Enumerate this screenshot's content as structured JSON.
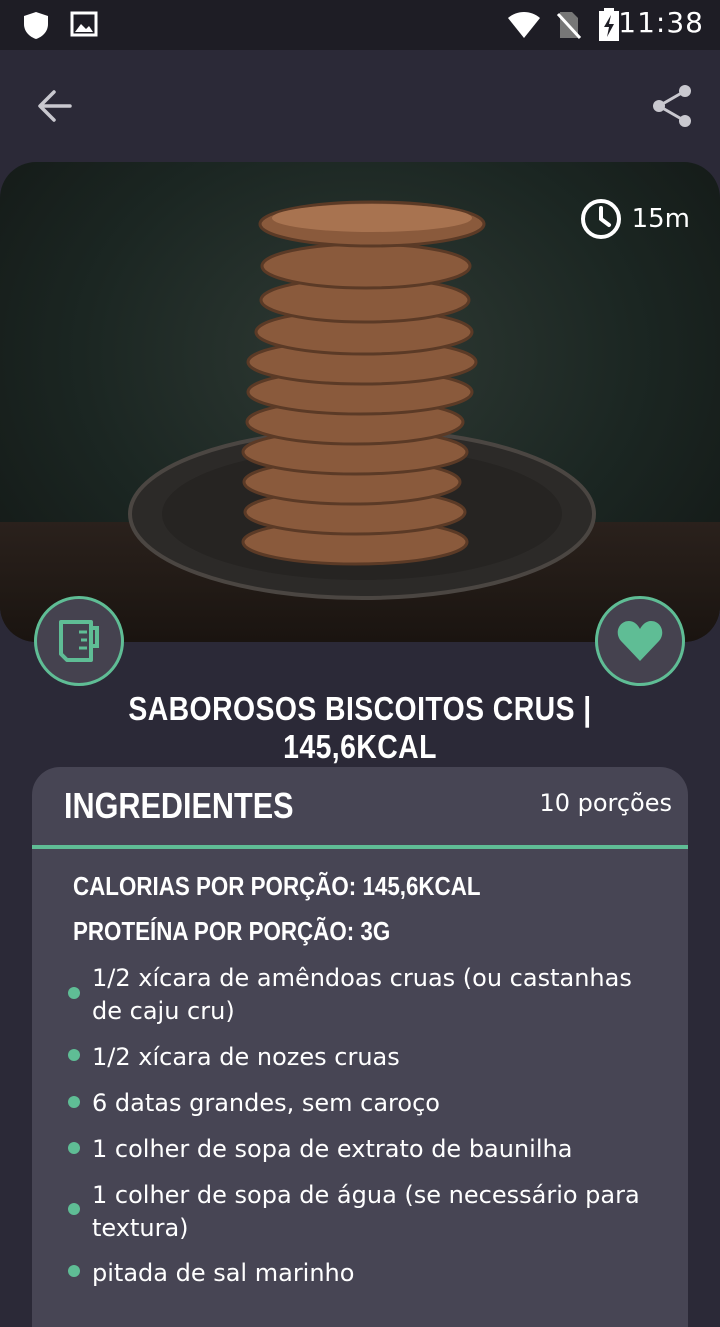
{
  "status_bar": {
    "time": "11:38"
  },
  "hero": {
    "time_label": "15m"
  },
  "recipe": {
    "title": "SABOROSOS BISCOITOS CRUS | 145,6KCAL"
  },
  "ingredients": {
    "heading": "INGREDIENTES",
    "portions": "10 porções",
    "calories": "CALORIAS POR PORÇÃO: 145,6KCAL",
    "protein": "PROTEÍNA POR PORÇÃO: 3G",
    "items": [
      "1/2 xícara de amêndoas cruas (ou castanhas de caju cru)",
      "1/2 xícara de nozes cruas",
      "6 datas grandes, sem caroço",
      "1 colher de sopa de extrato de baunilha",
      "1 colher de sopa de água (se necessário para textura)",
      "pitada de sal marinho"
    ]
  },
  "colors": {
    "accent": "#5fbd95",
    "background": "#2b2937",
    "card": "#474554"
  }
}
